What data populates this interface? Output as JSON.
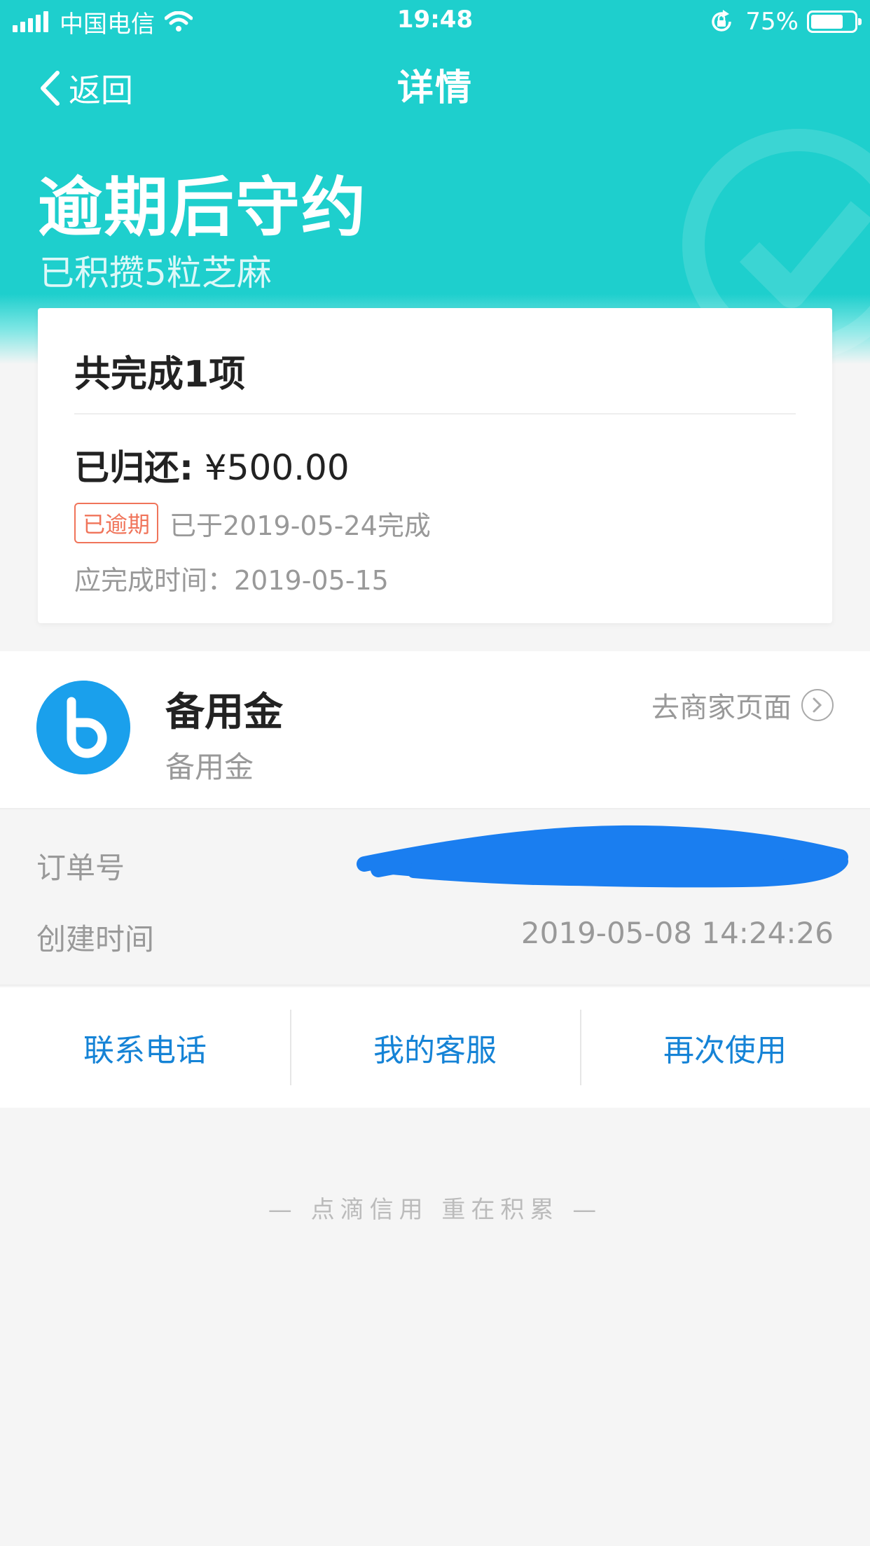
{
  "status_bar": {
    "carrier": "中国电信",
    "time": "19:48",
    "battery": "75%",
    "battery_level": 0.75
  },
  "nav": {
    "back_label": "返回",
    "title": "详情"
  },
  "hero": {
    "title": "逾期后守约",
    "subtitle": "已积攒5粒芝麻"
  },
  "summary": {
    "title": "共完成1项",
    "returned_label": "已归还:",
    "returned_amount": "¥500.00",
    "badge": "已逾期",
    "completed_text": "已于2019-05-24完成",
    "due_text": "应完成时间：2019-05-15"
  },
  "merchant": {
    "name": "备用金",
    "sub": "备用金",
    "link_label": "去商家页面"
  },
  "order": {
    "order_label": "订单号",
    "created_label": "创建时间",
    "created_value": "2019-05-08 14:24:26"
  },
  "actions": {
    "contact": "联系电话",
    "service": "我的客服",
    "reuse": "再次使用"
  },
  "footer": "— 点滴信用 重在积累 —",
  "colors": {
    "header": "#1ecfcd",
    "link_blue": "#1583d6",
    "overdue": "#f0745a",
    "logo_blue": "#1aa0ec",
    "scribble": "#1a7ef0"
  }
}
